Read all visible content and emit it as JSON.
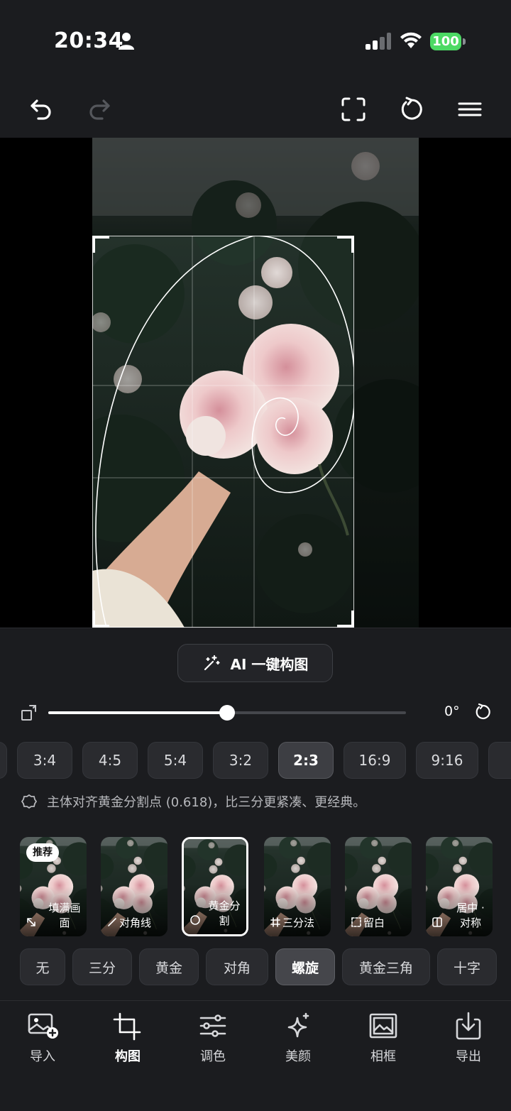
{
  "status_bar": {
    "time": "20:34",
    "battery": "100",
    "battery_color": "#4cd964"
  },
  "toolbar": {
    "undo_icon": "undo-icon",
    "redo_icon": "redo-icon",
    "fullscreen_icon": "fullscreen-icon",
    "rotate_icon": "rotate-icon",
    "menu_icon": "menu-icon"
  },
  "ai_button": {
    "label": "AI 一键构图"
  },
  "rotation": {
    "angle_label": "0°",
    "level": 0.5
  },
  "ratios": [
    "3:4",
    "4:5",
    "5:4",
    "3:2",
    "2:3",
    "16:9",
    "9:16"
  ],
  "selected_ratio": "2:3",
  "hint": "主体对齐黄金分割点 (0.618)，比三分更紧凑、更经典。",
  "compositions": [
    {
      "label": "填满画面",
      "badge": "推荐",
      "icon": "expand-icon"
    },
    {
      "label": "对角线",
      "icon": "diagonal-icon"
    },
    {
      "label": "黄金分割",
      "icon": "golden-ratio-icon",
      "selected": true
    },
    {
      "label": "三分法",
      "icon": "grid-icon"
    },
    {
      "label": "留白",
      "icon": "whitespace-icon"
    },
    {
      "label": "居中 · 对称",
      "icon": "center-icon"
    }
  ],
  "grid_overlays": [
    "无",
    "三分",
    "黄金",
    "对角",
    "螺旋",
    "黄金三角",
    "十字"
  ],
  "selected_grid": "螺旋",
  "bottom_nav": [
    {
      "label": "导入",
      "icon": "import-image-icon"
    },
    {
      "label": "构图",
      "icon": "crop-icon",
      "active": true
    },
    {
      "label": "调色",
      "icon": "adjust-sliders-icon"
    },
    {
      "label": "美颜",
      "icon": "sparkle-icon"
    },
    {
      "label": "相框",
      "icon": "frame-icon"
    },
    {
      "label": "导出",
      "icon": "export-icon"
    }
  ],
  "accent": "#ffffff",
  "background": "#1b1c1f"
}
